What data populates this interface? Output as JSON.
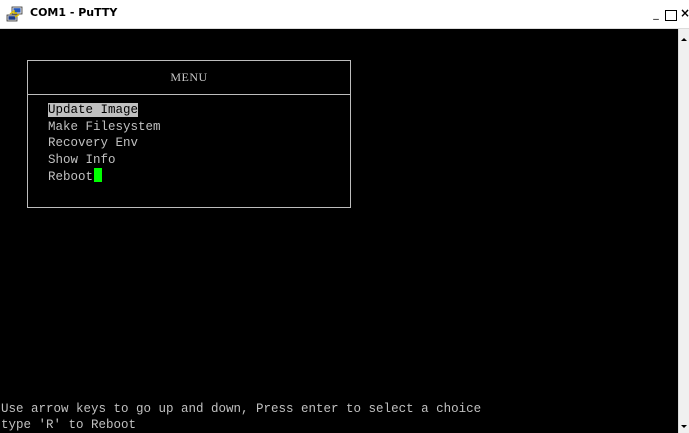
{
  "window": {
    "title": "COM1 - PuTTY",
    "minimize_label": "_",
    "close_label": "×"
  },
  "menu": {
    "title": "MENU",
    "items": [
      {
        "label": "Update Image",
        "selected": true
      },
      {
        "label": "Make Filesystem",
        "selected": false
      },
      {
        "label": "Recovery Env",
        "selected": false
      },
      {
        "label": "Show Info",
        "selected": false
      },
      {
        "label": "Reboot",
        "selected": false
      }
    ]
  },
  "status": {
    "line1": "Use arrow keys to go up and down, Press enter to select a choice",
    "line2": "type 'R' to Reboot"
  },
  "colors": {
    "terminal_bg": "#000000",
    "terminal_fg": "#c0c0c0",
    "cursor": "#00ff00",
    "selection_bg": "#c0c0c0"
  },
  "icons": {
    "app": "putty-icon",
    "scroll_up": "arrow-up-icon",
    "scroll_down": "arrow-down-icon"
  }
}
